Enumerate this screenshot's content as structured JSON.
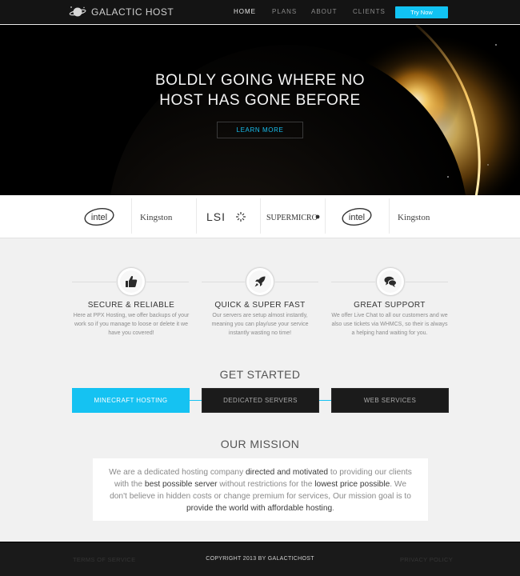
{
  "nav": {
    "brand": "GALACTIC HOST",
    "links": [
      {
        "label": "HOME",
        "active": true
      },
      {
        "label": "PLANS",
        "active": false
      },
      {
        "label": "ABOUT",
        "active": false
      },
      {
        "label": "CLIENTS",
        "active": false
      }
    ],
    "cta": "Try Now"
  },
  "hero": {
    "title_line1": "BOLDLY GOING WHERE NO",
    "title_line2": "HOST HAS GONE BEFORE",
    "button": "LEARN MORE"
  },
  "partners": [
    {
      "name": "intel",
      "icon": "intel-logo"
    },
    {
      "name": "Kingston",
      "icon": "kingston-logo"
    },
    {
      "name": "LSI",
      "icon": "lsi-logo"
    },
    {
      "name": "SUPERMICRO",
      "icon": "supermicro-logo"
    },
    {
      "name": "intel",
      "icon": "intel-logo"
    },
    {
      "name": "Kingston",
      "icon": "kingston-logo"
    }
  ],
  "features": [
    {
      "title": "SECURE & RELIABLE",
      "icon": "thumbs-up-icon",
      "text": "Here at PPX Hosting, we offer backups of your work so if you manage to loose or delete it we have you covered!"
    },
    {
      "title": "QUICK & SUPER FAST",
      "icon": "rocket-icon",
      "text": "Our servers are setup almost instantly, meaning you can play/use your service instantly wasting no time!"
    },
    {
      "title": "GREAT SUPPORT",
      "icon": "chat-bubbles-icon",
      "text": "We offer Live Chat to all our customers and we also use tickets via WHMCS, so their is always a helping hand waiting for you."
    }
  ],
  "get_started": {
    "title": "GET STARTED",
    "options": [
      "MINECRAFT HOSTING",
      "DEDICATED SERVERS",
      "WEB SERVICES"
    ]
  },
  "mission": {
    "title": "OUR MISSION",
    "p1": "We are a dedicated hosting company ",
    "h1": "directed and motivated",
    "p2": " to providing our clients with the ",
    "h2": "best possible server",
    "p3": " without restrictions for the ",
    "h3": "lowest price possible",
    "p4": ". We don't believe in hidden costs or change premium for services, Our mission goal is to ",
    "h4": "provide the world with affordable hosting",
    "p5": "."
  },
  "footer": {
    "terms": "TERMS OF SERVICE",
    "copyright": "COPYRIGHT 2013 BY GALACTICHOST",
    "privacy": "PRIVACY POLICY"
  },
  "colors": {
    "accent": "#15c2f2",
    "nav_bg": "#141414",
    "footer_bg": "#1a1a1a",
    "page_bg": "#f1f1f1"
  }
}
